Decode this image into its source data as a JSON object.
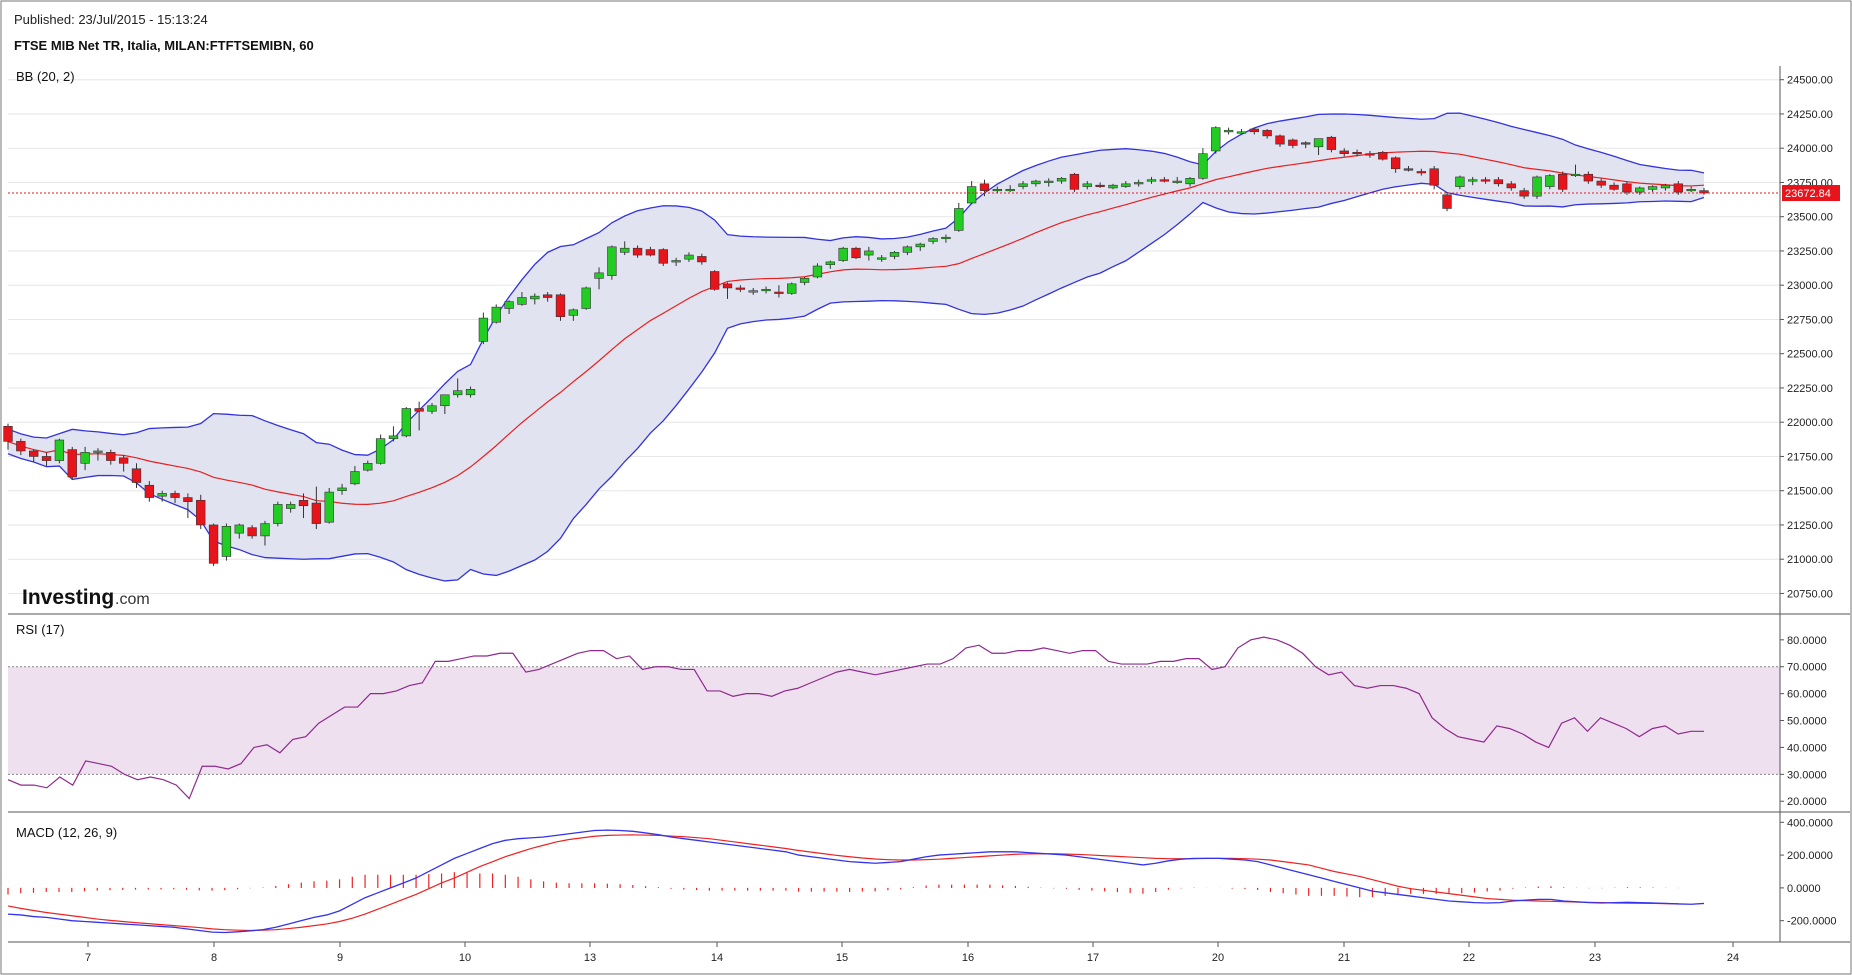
{
  "header": {
    "published": "Published: 23/Jul/2015 - 15:13:24",
    "instrument": "FTSE MIB Net TR, Italia, MILAN:FTFTSEMIBN, 60"
  },
  "logo": {
    "brand": "Investing",
    "domain": ".com"
  },
  "colors": {
    "up": "#22cc22",
    "down": "#e8141c",
    "band_line": "#3333dd",
    "band_fill": "#e2e3f0",
    "sma": "#e82020",
    "rsi_line": "#8e2a8e",
    "rsi_zone": "#efe0ef",
    "macd": "#3333ee",
    "signal": "#ee2222",
    "hist": "#ee2222",
    "price_tag": "#e8141c"
  },
  "panels": {
    "price": {
      "label": "BB (20, 2)",
      "ymin": 20600,
      "ymax": 24600,
      "ticks": [
        "24500.00",
        "24250.00",
        "24000.00",
        "23750.00",
        "23500.00",
        "23250.00",
        "23000.00",
        "22750.00",
        "22500.00",
        "22250.00",
        "22000.00",
        "21750.00",
        "21500.00",
        "21250.00",
        "21000.00",
        "20750.00"
      ]
    },
    "rsi": {
      "label": "RSI (17)",
      "ymin": 16,
      "ymax": 87,
      "upper": 70,
      "lower": 30,
      "ticks": [
        "80.0000",
        "70.0000",
        "60.0000",
        "50.0000",
        "40.0000",
        "30.0000",
        "20.0000"
      ]
    },
    "macd": {
      "label": "MACD (12, 26, 9)",
      "ymin": -330,
      "ymax": 420,
      "ticks": [
        "400.0000",
        "200.0000",
        "0.0000",
        "-200.0000"
      ]
    }
  },
  "current_price": "23672.84",
  "chart_data": [
    {
      "type": "candlestick",
      "title": "BB (20, 2)",
      "x_labels": [
        "7",
        "8",
        "9",
        "10",
        "13",
        "14",
        "15",
        "16",
        "17",
        "20",
        "21",
        "22",
        "23",
        "24"
      ],
      "ylim": [
        20600,
        24600
      ],
      "candles": [
        [
          21970,
          21990,
          21800,
          21860
        ],
        [
          21860,
          21880,
          21760,
          21790
        ],
        [
          21790,
          21800,
          21710,
          21750
        ],
        [
          21750,
          21780,
          21680,
          21720
        ],
        [
          21720,
          21880,
          21700,
          21870
        ],
        [
          21800,
          21820,
          21580,
          21600
        ],
        [
          21700,
          21820,
          21650,
          21780
        ],
        [
          21780,
          21810,
          21720,
          21790
        ],
        [
          21780,
          21800,
          21690,
          21720
        ],
        [
          21740,
          21760,
          21640,
          21700
        ],
        [
          21660,
          21700,
          21520,
          21560
        ],
        [
          21540,
          21570,
          21420,
          21450
        ],
        [
          21460,
          21500,
          21420,
          21480
        ],
        [
          21480,
          21500,
          21410,
          21450
        ],
        [
          21450,
          21480,
          21300,
          21420
        ],
        [
          21430,
          21470,
          21220,
          21250
        ],
        [
          21250,
          21260,
          20950,
          20970
        ],
        [
          21020,
          21260,
          20990,
          21240
        ],
        [
          21190,
          21260,
          21150,
          21250
        ],
        [
          21230,
          21250,
          21150,
          21170
        ],
        [
          21170,
          21280,
          21100,
          21260
        ],
        [
          21260,
          21420,
          21240,
          21400
        ],
        [
          21370,
          21420,
          21340,
          21400
        ],
        [
          21430,
          21480,
          21300,
          21390
        ],
        [
          21410,
          21530,
          21220,
          21260
        ],
        [
          21270,
          21520,
          21260,
          21490
        ],
        [
          21500,
          21550,
          21470,
          21520
        ],
        [
          21550,
          21680,
          21540,
          21640
        ],
        [
          21650,
          21720,
          21640,
          21700
        ],
        [
          21700,
          21910,
          21690,
          21880
        ],
        [
          21880,
          21970,
          21860,
          21900
        ],
        [
          21900,
          22110,
          21890,
          22100
        ],
        [
          22100,
          22150,
          21940,
          22080
        ],
        [
          22080,
          22140,
          22060,
          22120
        ],
        [
          22120,
          22180,
          22060,
          22200
        ],
        [
          22200,
          22320,
          22180,
          22230
        ],
        [
          22200,
          22260,
          22180,
          22240
        ],
        [
          22590,
          22800,
          22570,
          22760
        ],
        [
          22730,
          22860,
          22720,
          22840
        ],
        [
          22830,
          22890,
          22790,
          22880
        ],
        [
          22860,
          22950,
          22850,
          22910
        ],
        [
          22900,
          22940,
          22860,
          22920
        ],
        [
          22930,
          22950,
          22880,
          22910
        ],
        [
          22930,
          22940,
          22740,
          22770
        ],
        [
          22780,
          22830,
          22740,
          22820
        ],
        [
          22830,
          22990,
          22820,
          22980
        ],
        [
          23050,
          23130,
          22970,
          23090
        ],
        [
          23070,
          23290,
          23040,
          23280
        ],
        [
          23240,
          23320,
          23220,
          23270
        ],
        [
          23270,
          23290,
          23200,
          23220
        ],
        [
          23260,
          23280,
          23210,
          23220
        ],
        [
          23260,
          23270,
          23140,
          23160
        ],
        [
          23170,
          23200,
          23140,
          23180
        ],
        [
          23190,
          23240,
          23170,
          23220
        ],
        [
          23210,
          23230,
          23150,
          23170
        ],
        [
          23100,
          23110,
          22960,
          22970
        ],
        [
          23010,
          23020,
          22900,
          22980
        ],
        [
          22980,
          23000,
          22950,
          22970
        ],
        [
          22960,
          22980,
          22930,
          22960
        ],
        [
          22960,
          22990,
          22940,
          22970
        ],
        [
          22950,
          23000,
          22910,
          22940
        ],
        [
          22940,
          23020,
          22930,
          23010
        ],
        [
          23020,
          23060,
          23000,
          23050
        ],
        [
          23060,
          23160,
          23050,
          23140
        ],
        [
          23150,
          23180,
          23120,
          23170
        ],
        [
          23180,
          23280,
          23170,
          23270
        ],
        [
          23270,
          23280,
          23190,
          23200
        ],
        [
          23220,
          23280,
          23180,
          23250
        ],
        [
          23200,
          23220,
          23170,
          23200
        ],
        [
          23210,
          23250,
          23190,
          23240
        ],
        [
          23240,
          23290,
          23220,
          23280
        ],
        [
          23280,
          23310,
          23250,
          23300
        ],
        [
          23320,
          23350,
          23300,
          23340
        ],
        [
          23340,
          23370,
          23310,
          23350
        ],
        [
          23400,
          23600,
          23390,
          23560
        ],
        [
          23600,
          23760,
          23590,
          23720
        ],
        [
          23740,
          23770,
          23650,
          23690
        ],
        [
          23690,
          23720,
          23670,
          23700
        ],
        [
          23690,
          23730,
          23680,
          23700
        ],
        [
          23720,
          23760,
          23700,
          23740
        ],
        [
          23740,
          23770,
          23720,
          23760
        ],
        [
          23750,
          23780,
          23720,
          23760
        ],
        [
          23760,
          23790,
          23740,
          23780
        ],
        [
          23810,
          23820,
          23680,
          23700
        ],
        [
          23720,
          23760,
          23700,
          23740
        ],
        [
          23730,
          23750,
          23710,
          23720
        ],
        [
          23710,
          23740,
          23700,
          23730
        ],
        [
          23720,
          23760,
          23710,
          23740
        ],
        [
          23740,
          23770,
          23720,
          23750
        ],
        [
          23760,
          23790,
          23740,
          23770
        ],
        [
          23770,
          23790,
          23750,
          23760
        ],
        [
          23760,
          23790,
          23740,
          23760
        ],
        [
          23740,
          23790,
          23720,
          23780
        ],
        [
          23780,
          24000,
          23770,
          23960
        ],
        [
          23980,
          24160,
          23960,
          24150
        ],
        [
          24120,
          24150,
          24100,
          24130
        ],
        [
          24120,
          24140,
          24100,
          24120
        ],
        [
          24140,
          24150,
          24100,
          24120
        ],
        [
          24130,
          24140,
          24070,
          24090
        ],
        [
          24090,
          24100,
          24010,
          24030
        ],
        [
          24060,
          24070,
          24000,
          24020
        ],
        [
          24040,
          24050,
          24000,
          24030
        ],
        [
          24010,
          24070,
          23950,
          24070
        ],
        [
          24080,
          24090,
          23970,
          23990
        ],
        [
          23980,
          24000,
          23940,
          23960
        ],
        [
          23970,
          23990,
          23940,
          23960
        ],
        [
          23960,
          23980,
          23930,
          23950
        ],
        [
          23970,
          23980,
          23910,
          23920
        ],
        [
          23930,
          23940,
          23820,
          23850
        ],
        [
          23850,
          23870,
          23830,
          23840
        ],
        [
          23830,
          23850,
          23800,
          23820
        ],
        [
          23850,
          23870,
          23700,
          23730
        ],
        [
          23660,
          23680,
          23540,
          23560
        ],
        [
          23720,
          23800,
          23700,
          23790
        ],
        [
          23760,
          23790,
          23730,
          23770
        ],
        [
          23770,
          23790,
          23740,
          23760
        ],
        [
          23770,
          23790,
          23720,
          23740
        ],
        [
          23740,
          23760,
          23690,
          23710
        ],
        [
          23690,
          23710,
          23630,
          23650
        ],
        [
          23650,
          23800,
          23630,
          23790
        ],
        [
          23720,
          23810,
          23700,
          23800
        ],
        [
          23810,
          23830,
          23680,
          23700
        ],
        [
          23800,
          23880,
          23790,
          23810
        ],
        [
          23810,
          23830,
          23740,
          23760
        ],
        [
          23760,
          23780,
          23710,
          23730
        ],
        [
          23730,
          23750,
          23690,
          23700
        ],
        [
          23740,
          23760,
          23660,
          23680
        ],
        [
          23680,
          23720,
          23660,
          23710
        ],
        [
          23700,
          23730,
          23680,
          23720
        ],
        [
          23710,
          23740,
          23690,
          23730
        ],
        [
          23740,
          23760,
          23660,
          23680
        ],
        [
          23700,
          23720,
          23680,
          23700
        ],
        [
          23690,
          23710,
          23660,
          23673
        ]
      ]
    },
    {
      "type": "line",
      "title": "RSI (17)",
      "ylim": [
        16,
        87
      ],
      "values": [
        28,
        26,
        26,
        25,
        29,
        26,
        35,
        34,
        33,
        30,
        28,
        29,
        28,
        26,
        21,
        33,
        33,
        32,
        34,
        40,
        41,
        38,
        43,
        44,
        49,
        52,
        55,
        55,
        60,
        60,
        61,
        63,
        64,
        72,
        72,
        73,
        74,
        74,
        75,
        75,
        68,
        69,
        71,
        73,
        75,
        76,
        76,
        73,
        74,
        69,
        70,
        70,
        69,
        69,
        61,
        61,
        59,
        60,
        60,
        59,
        61,
        62,
        64,
        66,
        68,
        69,
        68,
        67,
        68,
        69,
        70,
        71,
        71,
        73,
        77,
        78,
        75,
        75,
        76,
        76,
        77,
        76,
        75,
        76,
        76,
        72,
        71,
        71,
        71,
        72,
        72,
        73,
        73,
        69,
        70,
        77,
        80,
        81,
        80,
        78,
        75,
        70,
        67,
        68,
        63,
        62,
        63,
        63,
        62,
        60,
        51,
        47,
        44,
        43,
        42,
        48,
        47,
        45,
        42,
        40,
        49,
        51,
        46,
        51,
        49,
        47,
        44,
        47,
        48,
        45,
        46,
        46
      ]
    },
    {
      "type": "line",
      "title": "MACD (12, 26, 9)",
      "ylim": [
        -330,
        420
      ],
      "macd": [
        -160,
        -165,
        -175,
        -180,
        -190,
        -200,
        -205,
        -210,
        -215,
        -220,
        -225,
        -230,
        -235,
        -240,
        -250,
        -260,
        -270,
        -272,
        -268,
        -262,
        -255,
        -240,
        -220,
        -200,
        -180,
        -165,
        -140,
        -100,
        -60,
        -30,
        0,
        30,
        60,
        100,
        140,
        180,
        210,
        240,
        270,
        290,
        300,
        305,
        310,
        320,
        330,
        340,
        350,
        352,
        350,
        345,
        335,
        325,
        310,
        300,
        290,
        280,
        270,
        260,
        250,
        240,
        230,
        220,
        200,
        190,
        180,
        170,
        160,
        155,
        150,
        155,
        160,
        175,
        190,
        200,
        205,
        210,
        215,
        220,
        220,
        220,
        215,
        210,
        205,
        200,
        190,
        180,
        170,
        160,
        150,
        140,
        150,
        165,
        175,
        180,
        180,
        180,
        175,
        170,
        160,
        140,
        120,
        100,
        80,
        60,
        40,
        20,
        0,
        -20,
        -30,
        -40,
        -50,
        -60,
        -70,
        -80,
        -85,
        -90,
        -92,
        -90,
        -80,
        -75,
        -70,
        -70,
        -80,
        -85,
        -90,
        -92,
        -90,
        -88,
        -90,
        -92,
        -95,
        -98,
        -100,
        -95
      ],
      "signal": [
        -110,
        -125,
        -138,
        -150,
        -160,
        -170,
        -180,
        -190,
        -198,
        -205,
        -212,
        -218,
        -224,
        -230,
        -236,
        -242,
        -250,
        -255,
        -258,
        -260,
        -258,
        -255,
        -248,
        -240,
        -230,
        -220,
        -205,
        -185,
        -160,
        -130,
        -100,
        -70,
        -40,
        -5,
        30,
        60,
        95,
        130,
        160,
        190,
        215,
        240,
        260,
        280,
        295,
        305,
        315,
        320,
        322,
        323,
        322,
        320,
        316,
        312,
        306,
        300,
        290,
        280,
        270,
        260,
        250,
        240,
        228,
        218,
        208,
        198,
        190,
        182,
        176,
        172,
        170,
        170,
        172,
        175,
        180,
        185,
        190,
        195,
        200,
        205,
        207,
        208,
        208,
        206,
        204,
        200,
        196,
        192,
        188,
        184,
        180,
        178,
        178,
        178,
        180,
        180,
        180,
        178,
        175,
        170,
        160,
        150,
        140,
        120,
        100,
        85,
        70,
        50,
        30,
        10,
        -5,
        -15,
        -25,
        -35,
        -45,
        -55,
        -65,
        -70,
        -75,
        -78,
        -80,
        -82,
        -84,
        -86,
        -88,
        -90,
        -92,
        -93,
        -94,
        -95,
        -96,
        -97
      ]
    }
  ]
}
